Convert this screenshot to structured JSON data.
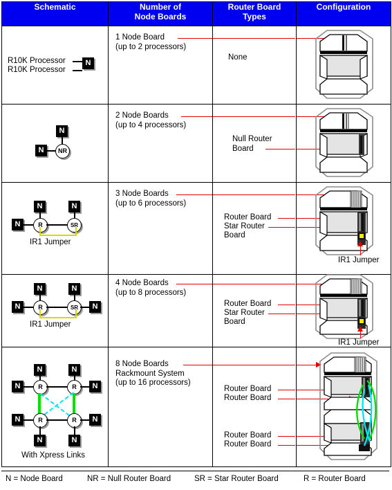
{
  "table": {
    "headers": [
      {
        "id": "schematic",
        "label": "Schematic"
      },
      {
        "id": "node_boards",
        "label": "Number of\nNode Boards"
      },
      {
        "id": "router_types",
        "label": "Router Board\nTypes"
      },
      {
        "id": "configuration",
        "label": "Configuration"
      }
    ],
    "header_bg": "#0000F0",
    "header_fg": "#FFFFFF",
    "pointer_color": "#E00000"
  },
  "rows": [
    {
      "id": "row-1-node-board",
      "node_boards": "1 Node Board\n(up to 2 processors)",
      "router_types": "None",
      "schematic": {
        "processor_labels": [
          "R10K Processor",
          "R10K Processor"
        ],
        "nodes": [
          "N"
        ],
        "caption": ""
      },
      "configuration": {
        "jumper_label": ""
      }
    },
    {
      "id": "row-2-node-boards",
      "node_boards": "2 Node Boards\n(up to 4 processors)",
      "router_types": "Null Router\nBoard",
      "schematic": {
        "processor_labels": [],
        "nodes": [
          "N",
          "N"
        ],
        "routers": [
          "NR"
        ],
        "caption": ""
      },
      "configuration": {
        "jumper_label": ""
      }
    },
    {
      "id": "row-3-node-boards",
      "node_boards": "3 Node Boards\n(up to 6 processors)",
      "router_types": "Router Board\nStar Router\nBoard",
      "router_lines": [
        "Router Board",
        "Star Router",
        "Board"
      ],
      "schematic": {
        "processor_labels": [],
        "nodes": [
          "N",
          "N",
          "N"
        ],
        "routers": [
          "R",
          "SR"
        ],
        "caption": "IR1 Jumper"
      },
      "configuration": {
        "jumper_label": "IR1 Jumper"
      }
    },
    {
      "id": "row-4-node-boards",
      "node_boards": "4 Node Boards\n(up to 8 processors)",
      "router_types": "Router Board\nStar Router\nBoard",
      "router_lines": [
        "Router Board",
        "Star Router",
        "Board"
      ],
      "schematic": {
        "processor_labels": [],
        "nodes": [
          "N",
          "N",
          "N",
          "N"
        ],
        "routers": [
          "R",
          "SR"
        ],
        "caption": "IR1 Jumper"
      },
      "configuration": {
        "jumper_label": "IR1 Jumper"
      }
    },
    {
      "id": "row-8-node-boards",
      "node_boards": "8 Node Boards\nRackmount System\n(up to 16 processors)",
      "router_types": "Router Board\nRouter Board\n\nRouter Board\nRouter Board",
      "router_lines": [
        "Router Board",
        "Router Board",
        "Router Board",
        "Router Board"
      ],
      "schematic": {
        "processor_labels": [],
        "nodes": [
          "N",
          "N",
          "N",
          "N",
          "N",
          "N",
          "N",
          "N"
        ],
        "routers": [
          "R",
          "R",
          "R",
          "R"
        ],
        "caption": "With Xpress Links"
      },
      "configuration": {
        "jumper_label": ""
      }
    }
  ],
  "legend": {
    "entries": [
      "N = Node Board",
      "NR = Null Router Board",
      "SR = Star Router Board",
      "R = Router Board"
    ]
  },
  "colors": {
    "header_blue": "#0000F0",
    "pointer_red": "#E00000",
    "jumper_yellow": "#D9D900",
    "xpress_green": "#00E000",
    "xpress_cyan": "#00E5EE",
    "chassis_gray": "#8C8C8C",
    "panel_gray": "#E4E4E4"
  }
}
